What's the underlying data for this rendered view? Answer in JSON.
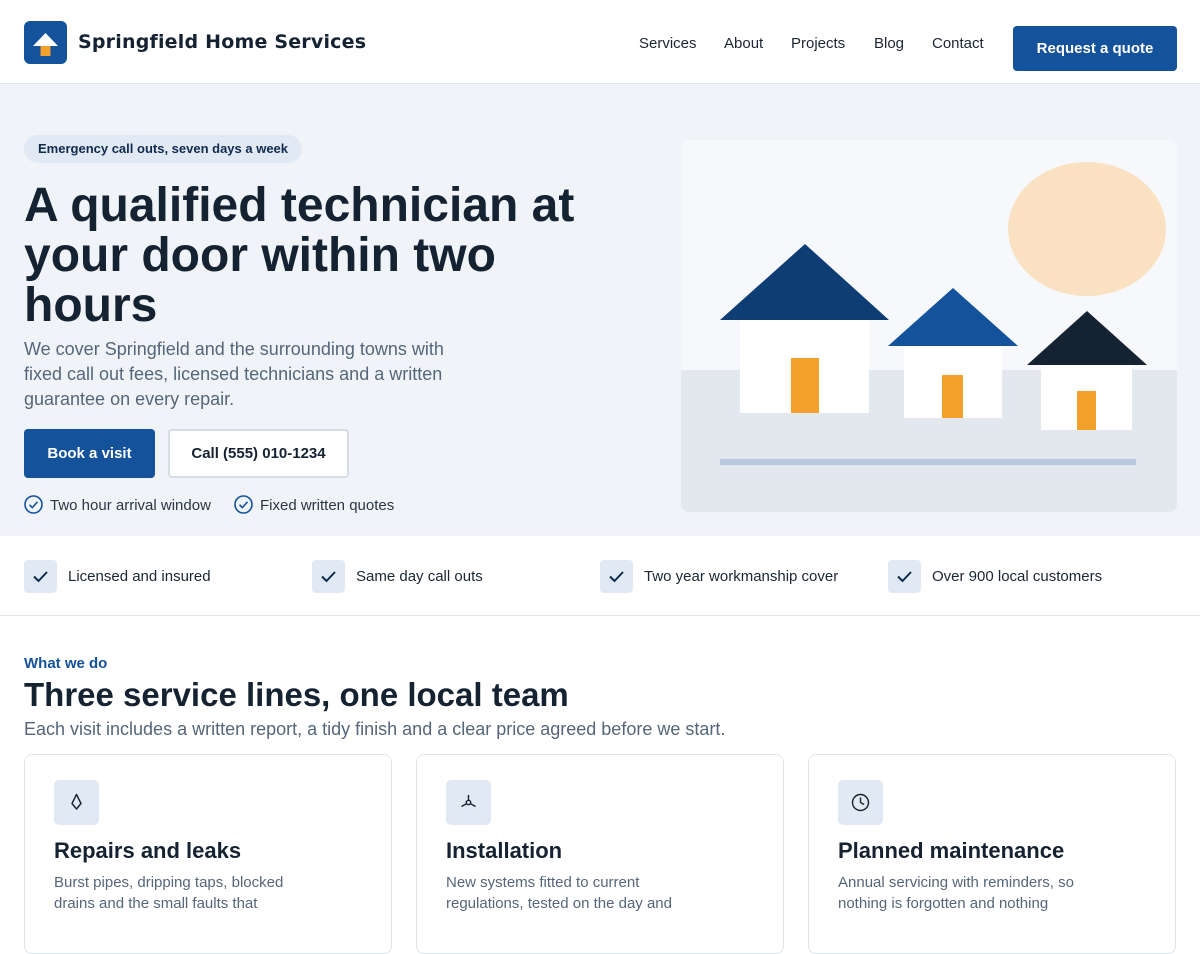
{
  "header": {
    "brand": "Springfield Home Services",
    "nav": [
      "Services",
      "About",
      "Projects",
      "Blog",
      "Contact"
    ],
    "cta": "Request a quote"
  },
  "hero": {
    "badge": "Emergency call outs, seven days a week",
    "title": "A qualified technician at your door within two hours",
    "description": "We cover Springfield and the surrounding towns with fixed call out fees, licensed technicians and a written guarantee on every repair.",
    "primary_button": "Book a visit",
    "secondary_button": "Call (555) 010-1234",
    "checks": [
      "Two hour arrival window",
      "Fixed written quotes"
    ]
  },
  "trust": [
    "Licensed and insured",
    "Same day call outs",
    "Two year workmanship cover",
    "Over 900 local customers"
  ],
  "services": {
    "eyebrow": "What we do",
    "title": "Three service lines, one local team",
    "subtitle": "Each visit includes a written report, a tidy finish and a clear price agreed before we start.",
    "cards": [
      {
        "icon": "droplet-icon",
        "title": "Repairs and leaks",
        "text": "Burst pipes, dripping taps, blocked drains and the small faults that"
      },
      {
        "icon": "fan-icon",
        "title": "Installation",
        "text": "New systems fitted to current regulations, tested on the day and"
      },
      {
        "icon": "clock-icon",
        "title": "Planned maintenance",
        "text": "Annual servicing with reminders, so nothing is forgotten and nothing"
      }
    ]
  },
  "colors": {
    "brand": "#14529b",
    "brand_dark": "#0e3d73",
    "accent": "#f4a12b",
    "ink": "#152231",
    "hero_bg": "#f0f4f8",
    "sun": "#fae1c2"
  }
}
